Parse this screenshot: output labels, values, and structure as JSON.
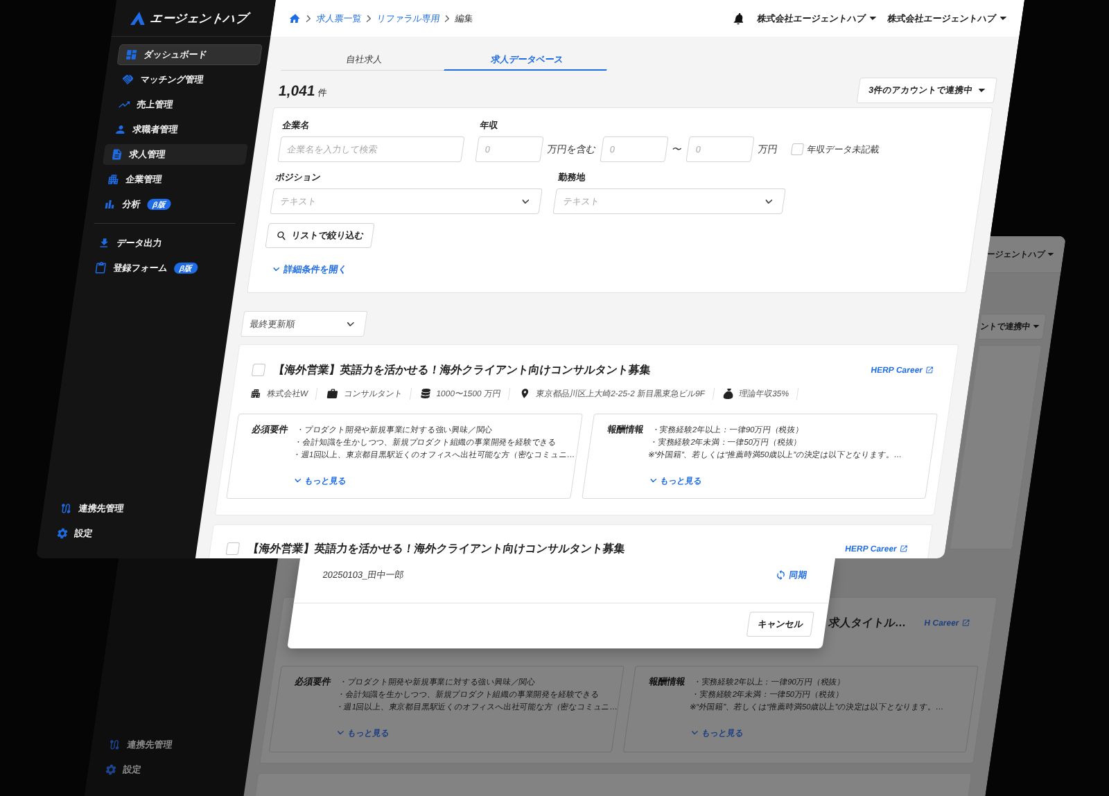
{
  "front_window": {
    "sidebar": {
      "logo": "エージェントハブ",
      "nav_groups": [
        {
          "items": [
            {
              "label": "ダッシュボード",
              "selected": false,
              "hovered": true
            },
            {
              "label": "マッチング管理",
              "selected": false,
              "hovered": false
            },
            {
              "label": "売上管理",
              "selected": false,
              "hovered": false
            },
            {
              "label": "求職者管理",
              "selected": false,
              "hovered": false
            },
            {
              "label": "求人管理",
              "selected": true,
              "hovered": false
            },
            {
              "label": "企業管理",
              "selected": false,
              "hovered": false
            },
            {
              "label": "分析",
              "badge": "β版",
              "selected": false,
              "hovered": false
            }
          ]
        },
        {
          "items": [
            {
              "label": "データ出力",
              "selected": false,
              "hovered": false
            },
            {
              "label": "登録フォーム",
              "badge": "β版",
              "selected": false,
              "hovered": false
            }
          ]
        }
      ],
      "footer_items": [
        {
          "label": "連携先管理",
          "selected": false,
          "hovered": false
        },
        {
          "label": "設定",
          "selected": false,
          "hovered": false
        }
      ]
    },
    "header": {
      "breadcrumb": [
        {
          "label": "求人票一覧",
          "current": false
        },
        {
          "label": "リファラル専用",
          "current": false
        },
        {
          "label": "編集",
          "current": true
        }
      ],
      "accounts": [
        "株式会社エージェントハブ",
        "株式会社エージェントハブ"
      ]
    },
    "tabs": [
      {
        "label": "自社求人",
        "selected": false
      },
      {
        "label": "求人データベース",
        "selected": true
      }
    ],
    "result_count": {
      "value": "1,041",
      "unit": "件"
    },
    "account_sync_button": "3件のアカウントで連携中",
    "filters": {
      "company": {
        "label": "企業名",
        "placeholder": "企業名を入力して検索"
      },
      "salary": {
        "label": "年収",
        "min_placeholder": "0",
        "min_suffix": "万円を含む",
        "range_from_placeholder": "0",
        "range_separator": "〜",
        "range_to_placeholder": "0",
        "range_suffix": "万円",
        "no_data_checkbox": {
          "label": "年収データ未記載",
          "checked": false
        }
      },
      "position": {
        "label": "ポジション",
        "placeholder": "テキスト"
      },
      "location": {
        "label": "勤務地",
        "placeholder": "テキスト"
      },
      "apply_button": "リストで絞り込む",
      "advanced_toggle": "詳細条件を開く"
    },
    "sort_select": "最終更新順",
    "jobs": [
      {
        "title": "【海外営業】英語力を活かせる！海外クライアント向けコンサルタント募集",
        "checked": false,
        "source_link": "HERP Career",
        "meta": [
          "株式会社W",
          "コンサルタント",
          "1000〜1500 万円",
          "東京都品川区上大崎2-25-2 新目黒東急ビル9F",
          "理論年収35%"
        ],
        "sections": [
          {
            "label": "必須要件",
            "lines": [
              "・プロダクト開発や新規事業に対する強い興味／関心",
              "・会計知識を生かしつつ、新規プロダクト組織の事業開発を経験できる",
              "・週1回以上、東京都目黒駅近くのオフィスへ出社可能な方（密なコミュニ…"
            ],
            "more_link": "もっと見る"
          },
          {
            "label": "報酬情報",
            "lines": [
              "・実務経験2年以上：一律90万円（税抜）",
              "・実務経験2年未満：一律50万円（税抜）",
              "※“外国籍”、若しくは“推薦時満50歳以上”の決定は以下となります。…"
            ],
            "more_link": "もっと見る"
          }
        ]
      },
      {
        "title": "【海外営業】英語力を活かせる！海外クライアント向けコンサルタント募集",
        "checked": false,
        "source_link": "HERP Career"
      }
    ]
  },
  "background_window": {
    "sidebar_footer_items": [
      {
        "label": "連携先管理",
        "selected": false
      },
      {
        "label": "設定",
        "selected": false
      }
    ],
    "account_menu": "ージェントハブ",
    "account_sync_button": "ントで連携中",
    "job": {
      "title": "求人タイトル…",
      "source_link": "H Career",
      "sections": [
        {
          "label": "必須要件",
          "lines": [
            "・プロダクト開発や新規事業に対する強い興味／関心",
            "・会計知識を生かしつつ、新規プロダクト組織の事業開発を経験できる",
            "・週1回以上、東京都目黒駅近くのオフィスへ出社可能な方（密なコミュニ…"
          ],
          "more_link": "もっと見る"
        },
        {
          "label": "報酬情報",
          "lines": [
            "・実務経験2年以上：一律90万円（税抜）",
            "・実務経験2年未満：一律50万円（税抜）",
            "※“外国籍”、若しくは“推薦時満50歳以上”の決定は以下となります。…"
          ],
          "more_link": "もっと見る"
        }
      ]
    },
    "dialog": {
      "item": "20250103_田中一郎",
      "sync_action": "同期",
      "cancel_button": "キャンセル"
    }
  }
}
